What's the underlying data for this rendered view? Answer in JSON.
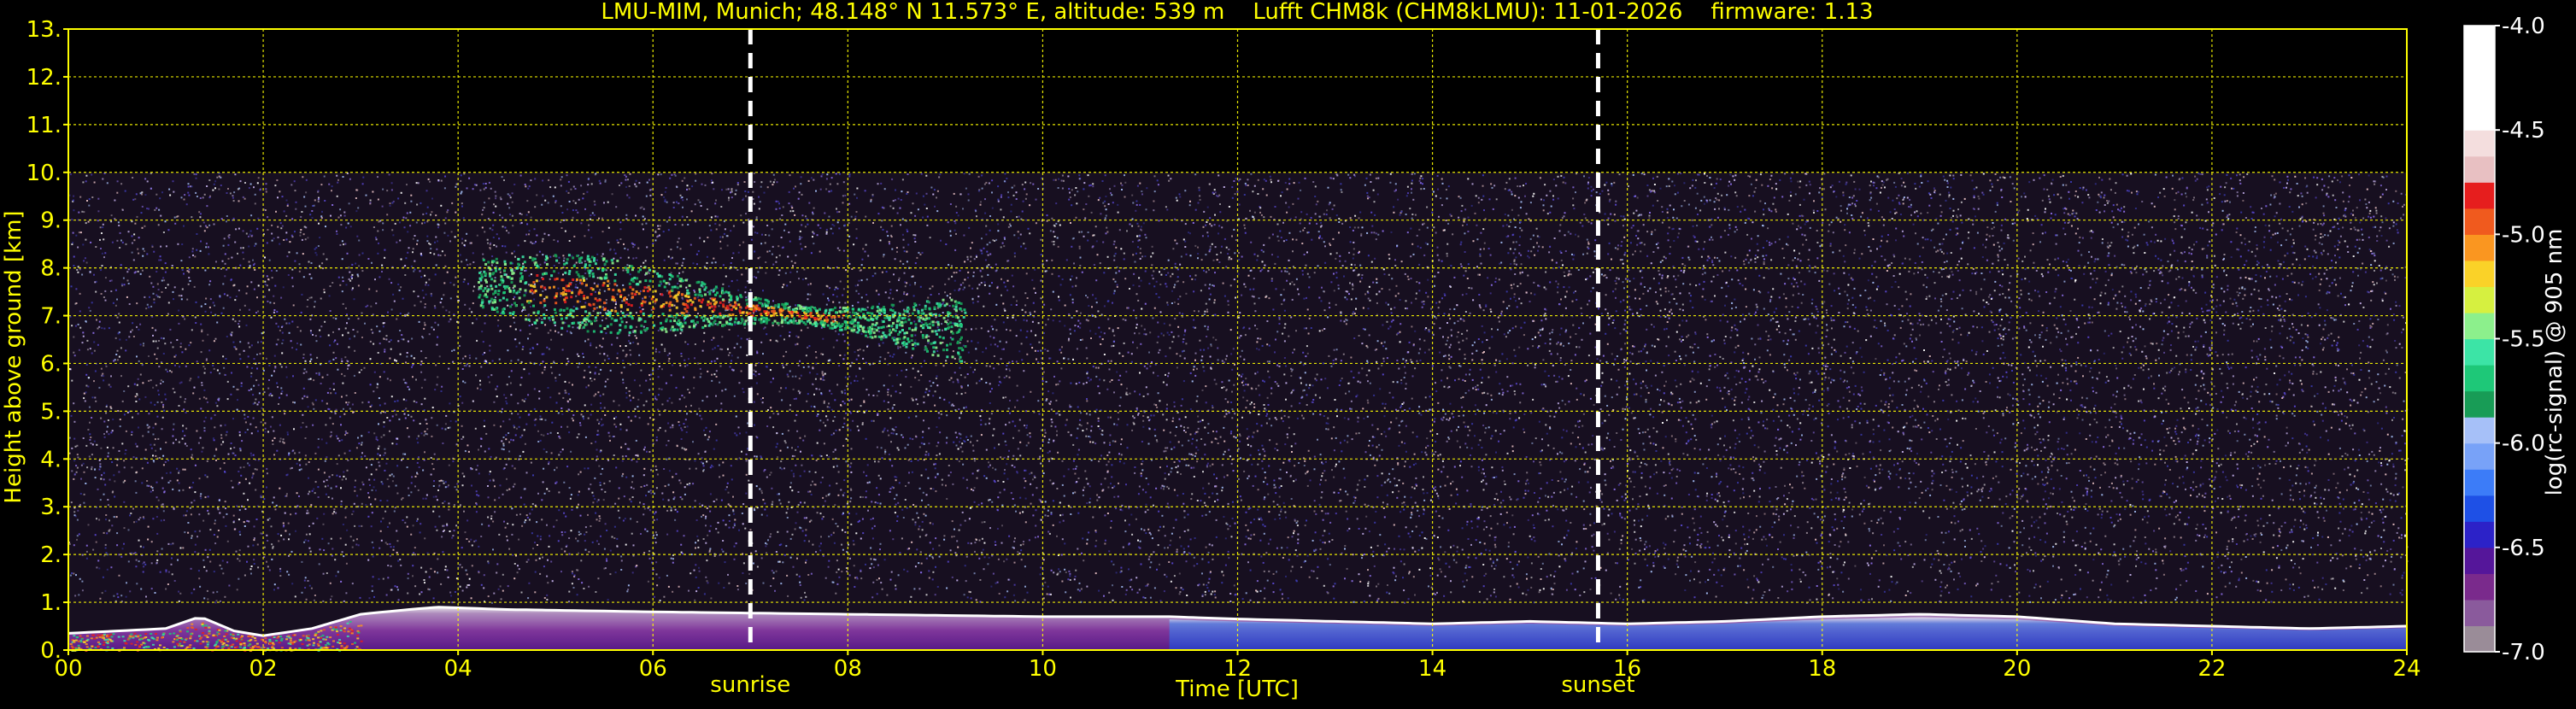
{
  "chart_data": {
    "type": "heatmap",
    "title": "LMU-MIM, Munich; 48.148° N 11.573° E, altitude: 539 m    Lufft CHM8k (CHM8kLMU): 11-01-2026    firmware: 1.13",
    "xlabel": "Time [UTC]",
    "ylabel": "Height above ground [km]",
    "xlim": [
      0,
      24
    ],
    "ylim": [
      0,
      13
    ],
    "x_ticks": [
      0,
      2,
      4,
      6,
      8,
      10,
      12,
      14,
      16,
      18,
      20,
      22,
      24
    ],
    "x_tick_labels": [
      "00",
      "02",
      "04",
      "06",
      "08",
      "10",
      "12",
      "14",
      "16",
      "18",
      "20",
      "22",
      "24"
    ],
    "y_ticks": [
      0,
      1,
      2,
      3,
      4,
      5,
      6,
      7,
      8,
      9,
      10,
      11,
      12,
      13
    ],
    "y_tick_labels": [
      "0.",
      "1.",
      "2.",
      "3.",
      "4.",
      "5.",
      "6.",
      "7.",
      "8.",
      "9.",
      "10.",
      "11.",
      "12.",
      "13."
    ],
    "grid": true,
    "data_top_km": 10.0,
    "markers": [
      {
        "label": "sunrise",
        "x": 7.0
      },
      {
        "label": "sunset",
        "x": 15.7
      }
    ],
    "colorbar": {
      "label": "log(rc-signal) @ 905 nm",
      "range": [
        -7.0,
        -4.0
      ],
      "ticks": [
        -7.0,
        -6.5,
        -6.0,
        -5.5,
        -5.0,
        -4.5,
        -4.0
      ],
      "tick_labels": [
        "-7.0",
        "-6.5",
        "-6.0",
        "-5.5",
        "-5.0",
        "-4.5",
        "-4.0"
      ],
      "colors": [
        "#9a8c98",
        "#8a5a9c",
        "#7a2a8c",
        "#55169a",
        "#2c22c8",
        "#1e50e6",
        "#3c7cf8",
        "#78a2f8",
        "#a6c0f8",
        "#189c56",
        "#1ec878",
        "#3ce4a6",
        "#8cf08c",
        "#d6f040",
        "#fad228",
        "#fa9620",
        "#f05a1e",
        "#e61e1e",
        "#e8c0c2",
        "#f4dede",
        "#ffffff",
        "#ffffff",
        "#ffffff",
        "#ffffff"
      ]
    },
    "boundary_layer_top_km": [
      [
        0.0,
        0.35
      ],
      [
        0.5,
        0.4
      ],
      [
        1.0,
        0.45
      ],
      [
        1.35,
        0.7
      ],
      [
        1.7,
        0.4
      ],
      [
        2.0,
        0.3
      ],
      [
        2.5,
        0.45
      ],
      [
        3.0,
        0.75
      ],
      [
        3.5,
        0.85
      ],
      [
        3.8,
        0.9
      ],
      [
        4.5,
        0.85
      ],
      [
        6.0,
        0.8
      ],
      [
        8.0,
        0.75
      ],
      [
        10.0,
        0.7
      ],
      [
        11.3,
        0.7
      ],
      [
        12.0,
        0.65
      ],
      [
        13.0,
        0.6
      ],
      [
        14.0,
        0.55
      ],
      [
        15.0,
        0.6
      ],
      [
        16.0,
        0.55
      ],
      [
        17.0,
        0.6
      ],
      [
        18.0,
        0.7
      ],
      [
        19.0,
        0.75
      ],
      [
        20.0,
        0.7
      ],
      [
        21.0,
        0.55
      ],
      [
        22.0,
        0.5
      ],
      [
        23.0,
        0.45
      ],
      [
        24.0,
        0.5
      ]
    ],
    "cloud_layer": {
      "x_range": [
        4.2,
        9.2
      ],
      "base_km": 6.0,
      "top_km": 8.3,
      "peak_log_signal": -5.0
    }
  }
}
